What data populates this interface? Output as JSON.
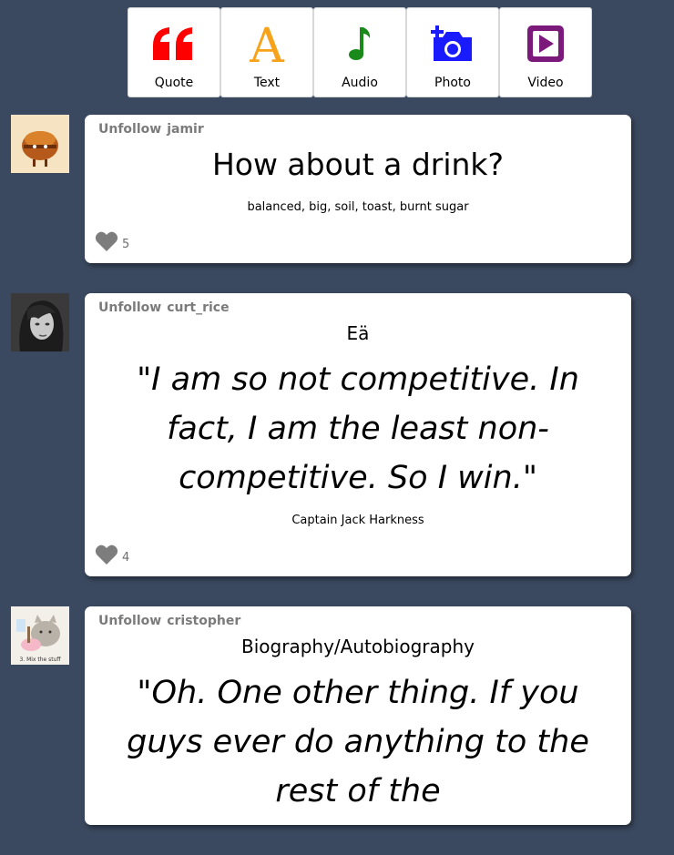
{
  "toolbar": {
    "buttons": [
      {
        "label": "Quote",
        "icon": "quote-icon",
        "color": "#ff0000"
      },
      {
        "label": "Text",
        "icon": "text-icon",
        "color": "#f7a21b"
      },
      {
        "label": "Audio",
        "icon": "music-note-icon",
        "color": "#1a8a1a"
      },
      {
        "label": "Photo",
        "icon": "camera-icon",
        "color": "#1a1aff"
      },
      {
        "label": "Video",
        "icon": "video-icon",
        "color": "#7b1a7b"
      }
    ]
  },
  "posts": [
    {
      "follow_label": "Unfollow",
      "username": "jamir",
      "title": "How about a drink?",
      "body": "balanced, big, soil, toast, burnt sugar",
      "likes": "5"
    },
    {
      "follow_label": "Unfollow",
      "username": "curt_rice",
      "heading": "Eä",
      "quote": "\"I am so not competitive. In fact, I am the least non-competitive. So I win.\"",
      "source": "Captain Jack Harkness",
      "likes": "4"
    },
    {
      "follow_label": "Unfollow",
      "username": "cristopher",
      "heading": "Biography/Autobiography",
      "quote": "\"Oh. One other thing. If you guys ever do anything to the rest of the"
    }
  ],
  "avatar_caption": "3. Mix the stuff",
  "colors": {
    "background": "#3b4960",
    "like_gray": "#7d7d7d"
  }
}
